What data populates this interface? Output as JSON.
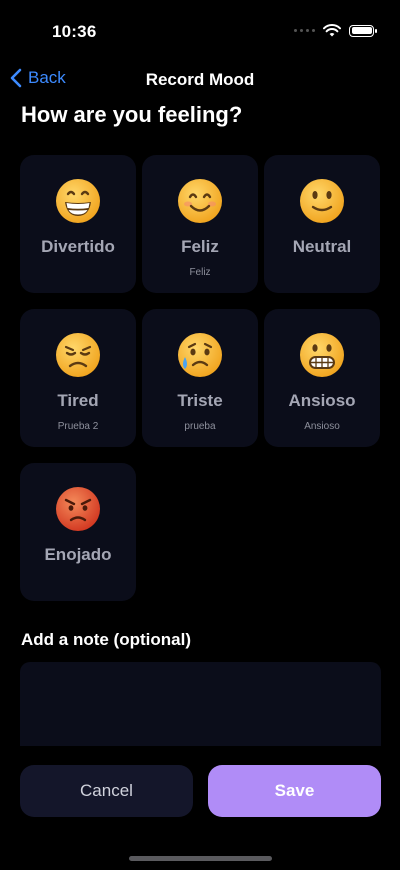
{
  "status_bar": {
    "time": "10:36"
  },
  "nav": {
    "back_label": "Back",
    "title": "Record Mood"
  },
  "page_title": "How are you feeling?",
  "moods": [
    {
      "label": "Divertido",
      "description": "",
      "icon": "grinning-face-icon"
    },
    {
      "label": "Feliz",
      "description": "Feliz",
      "icon": "smiling-face-icon"
    },
    {
      "label": "Neutral",
      "description": "",
      "icon": "slightly-smiling-face-icon"
    },
    {
      "label": "Tired",
      "description": "Prueba 2",
      "icon": "disappointed-face-icon"
    },
    {
      "label": "Triste",
      "description": "prueba",
      "icon": "sad-sweat-face-icon"
    },
    {
      "label": "Ansioso",
      "description": "Ansioso",
      "icon": "grimacing-face-icon"
    },
    {
      "label": "Enojado",
      "description": "",
      "icon": "angry-face-icon"
    }
  ],
  "note": {
    "label": "Add a note (optional)",
    "value": ""
  },
  "actions": {
    "cancel_label": "Cancel",
    "save_label": "Save"
  },
  "colors": {
    "accent": "#b08cf7",
    "link": "#3d8bff",
    "card_bg": "#0b0d1a",
    "background": "#000000"
  }
}
